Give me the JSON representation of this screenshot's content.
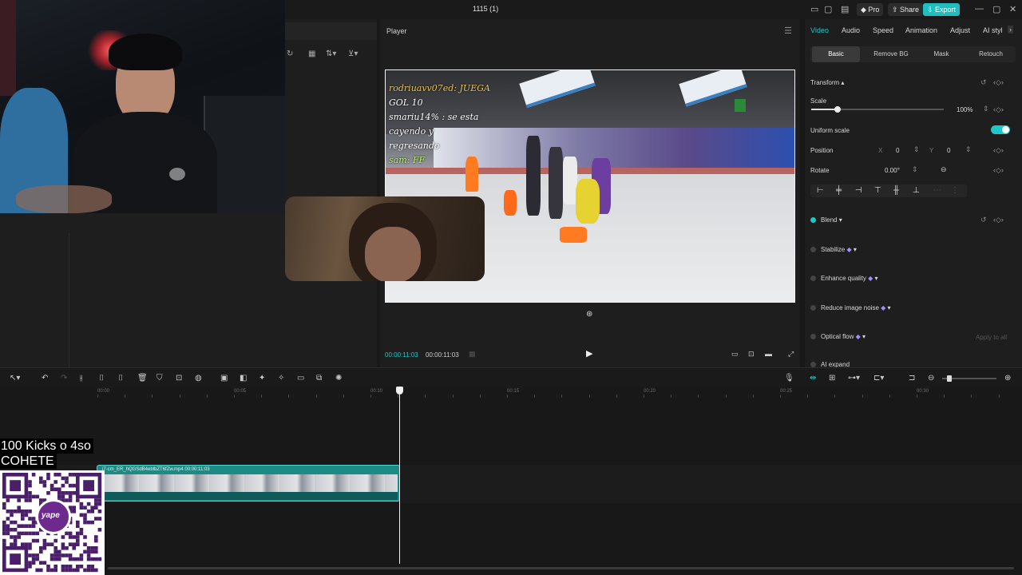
{
  "window": {
    "title": "1115 (1)"
  },
  "titlebar": {
    "pro": "Pro",
    "share": "Share",
    "export": "Export"
  },
  "player": {
    "title": "Player",
    "time_current": "00:00:11:03",
    "time_total": "00:00:11:03",
    "chat_lines": [
      "rodriuavv07ed: JUEGA",
      "GOL 10",
      "smariu14% : se esta cayendo y",
      "regresando",
      "sam: FF"
    ]
  },
  "right_panel": {
    "tabs": [
      "Video",
      "Audio",
      "Speed",
      "Animation",
      "Adjust",
      "AI styl"
    ],
    "subtabs": [
      "Basic",
      "Remove BG",
      "Mask",
      "Retouch"
    ],
    "transform": "Transform",
    "scale_label": "Scale",
    "scale_value": "100%",
    "scale_fraction": 0.2,
    "uniform_scale": "Uniform scale",
    "uniform_scale_on": true,
    "position_label": "Position",
    "x_label": "X",
    "x_value": "0",
    "y_label": "Y",
    "y_value": "0",
    "rotate_label": "Rotate",
    "rotate_value": "0.00°",
    "blend": "Blend",
    "stabilize": "Stabilize",
    "enhance_quality": "Enhance quality",
    "reduce_noise": "Reduce image noise",
    "optical_flow": "Optical flow",
    "apply_to_all": "Apply to all",
    "ai_expand": "AI expand"
  },
  "timeline": {
    "ticks": [
      "00:00",
      "00:05",
      "00:10",
      "00:15",
      "00:20",
      "00:25",
      "00:30"
    ],
    "clip_label": "i7-cm_ER_hQGSdB4eblbZT6fZw.mp4   00:00:11:03"
  },
  "overlays": {
    "kicks": "100 Kicks o 4so",
    "cohete": "COHETE",
    "qr_brand": "yape"
  },
  "colors": {
    "accent": "#1fc8c8",
    "clip": "#1e8a86"
  }
}
